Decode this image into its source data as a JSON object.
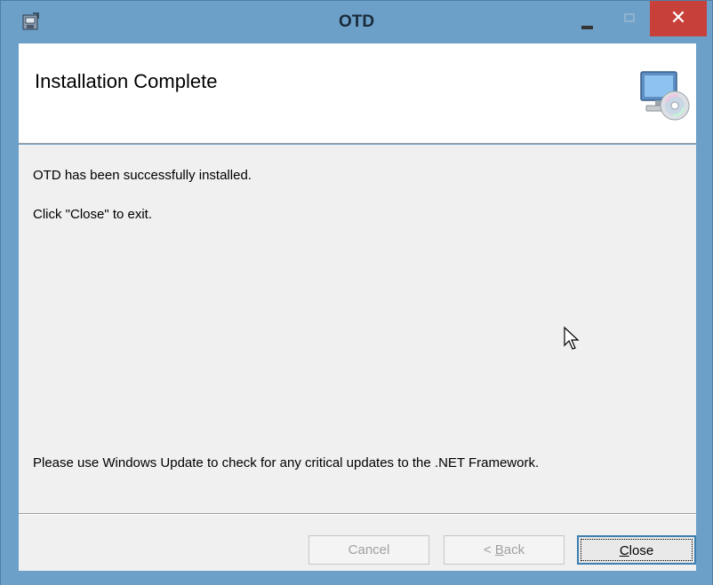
{
  "window": {
    "title": "OTD",
    "controls": {
      "minimize": "minimize-icon",
      "maximize": "maximize-icon",
      "close": "close-icon"
    },
    "colors": {
      "frame": "#6ca0c8",
      "close_button": "#c7403a"
    }
  },
  "header": {
    "title": "Installation Complete",
    "icon": "computer-cd-icon"
  },
  "body": {
    "line1": "OTD has been successfully installed.",
    "line2": "Click \"Close\" to exit.",
    "update_note": "Please use Windows Update to check for any critical updates to the .NET Framework."
  },
  "buttons": {
    "cancel": {
      "label": "Cancel",
      "enabled": false
    },
    "back": {
      "label_prefix": "< ",
      "label_mnemonic": "B",
      "label_rest": "ack",
      "enabled": false
    },
    "close": {
      "label_mnemonic": "C",
      "label_rest": "lose",
      "enabled": true
    }
  }
}
